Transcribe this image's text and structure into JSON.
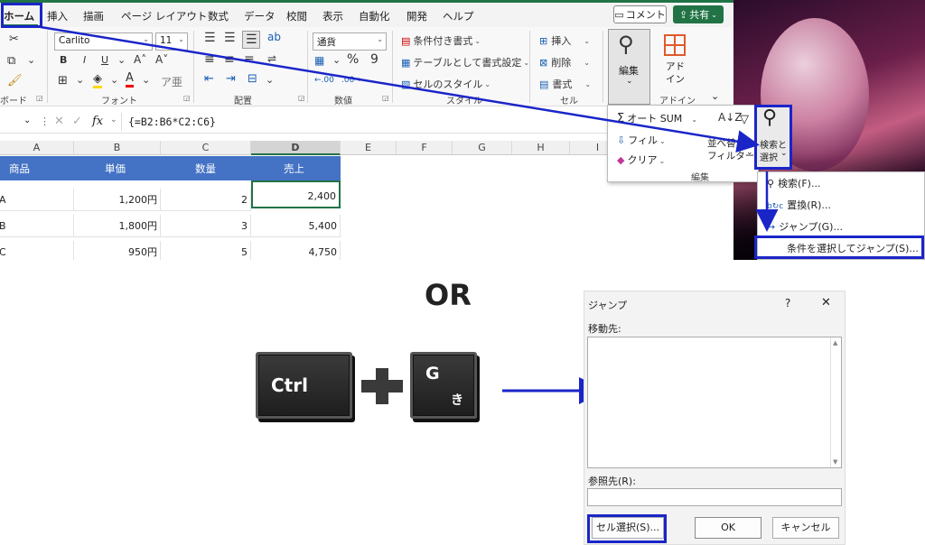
{
  "tabs": [
    "ホーム",
    "挿入",
    "描画",
    "ページ レイアウト",
    "数式",
    "データ",
    "校閲",
    "表示",
    "自動化",
    "開発",
    "ヘルプ"
  ],
  "header": {
    "comment": "コメント",
    "share": "共有"
  },
  "font": {
    "name": "Carlito",
    "size": "11",
    "bold": "B",
    "italic": "I",
    "underline": "U"
  },
  "number_format": "通貨",
  "styles": {
    "conditional": "条件付き書式",
    "table": "テーブルとして書式設定",
    "cell_style": "セルのスタイル"
  },
  "cells_group": {
    "insert": "挿入",
    "delete": "削除",
    "format": "書式"
  },
  "edit_big": "編集",
  "addin": {
    "line1": "アド",
    "line2": "イン",
    "group": "アドイン"
  },
  "groups": {
    "clipboard": "ボード",
    "font": "フォント",
    "alignment": "配置",
    "number": "数値",
    "style": "スタイル",
    "cell": "セル"
  },
  "formula": {
    "fx": "fx",
    "text": "{=B2:B6*C2:C6}"
  },
  "columns": [
    "A",
    "B",
    "C",
    "D",
    "E",
    "F",
    "G",
    "H",
    "I"
  ],
  "table": {
    "header": [
      "商品",
      "単価",
      "数量",
      "売上"
    ],
    "rows": [
      [
        "A",
        "1,200円",
        "2",
        "2,400"
      ],
      [
        "B",
        "1,800円",
        "3",
        "5,400"
      ],
      [
        "C",
        "950円",
        "5",
        "4,750"
      ]
    ]
  },
  "edit_popup": {
    "autosum": "オート SUM",
    "fill": "フィル",
    "clear": "クリア",
    "sort": "並べ替えと",
    "filter": "フィルター",
    "find1": "検索と",
    "find2": "選択",
    "group": "編集"
  },
  "find_menu": [
    "検索(F)...",
    "置換(R)...",
    "ジャンプ(G)...",
    "条件を選択してジャンプ(S)..."
  ],
  "or_label": "OR",
  "keys": {
    "ctrl": "Ctrl",
    "plus": "+",
    "g": "G",
    "g_kana": "き"
  },
  "dialog": {
    "title": "ジャンプ",
    "help": "?",
    "close": "✕",
    "goto_label": "移動先:",
    "ref_label": "参照先(R):",
    "special": "セル選択(S)...",
    "ok": "OK",
    "cancel": "キャンセル"
  },
  "colors": {
    "accent_blue": "#1a25c8",
    "header_fill": "#4472c4",
    "excel_green": "#217346"
  }
}
